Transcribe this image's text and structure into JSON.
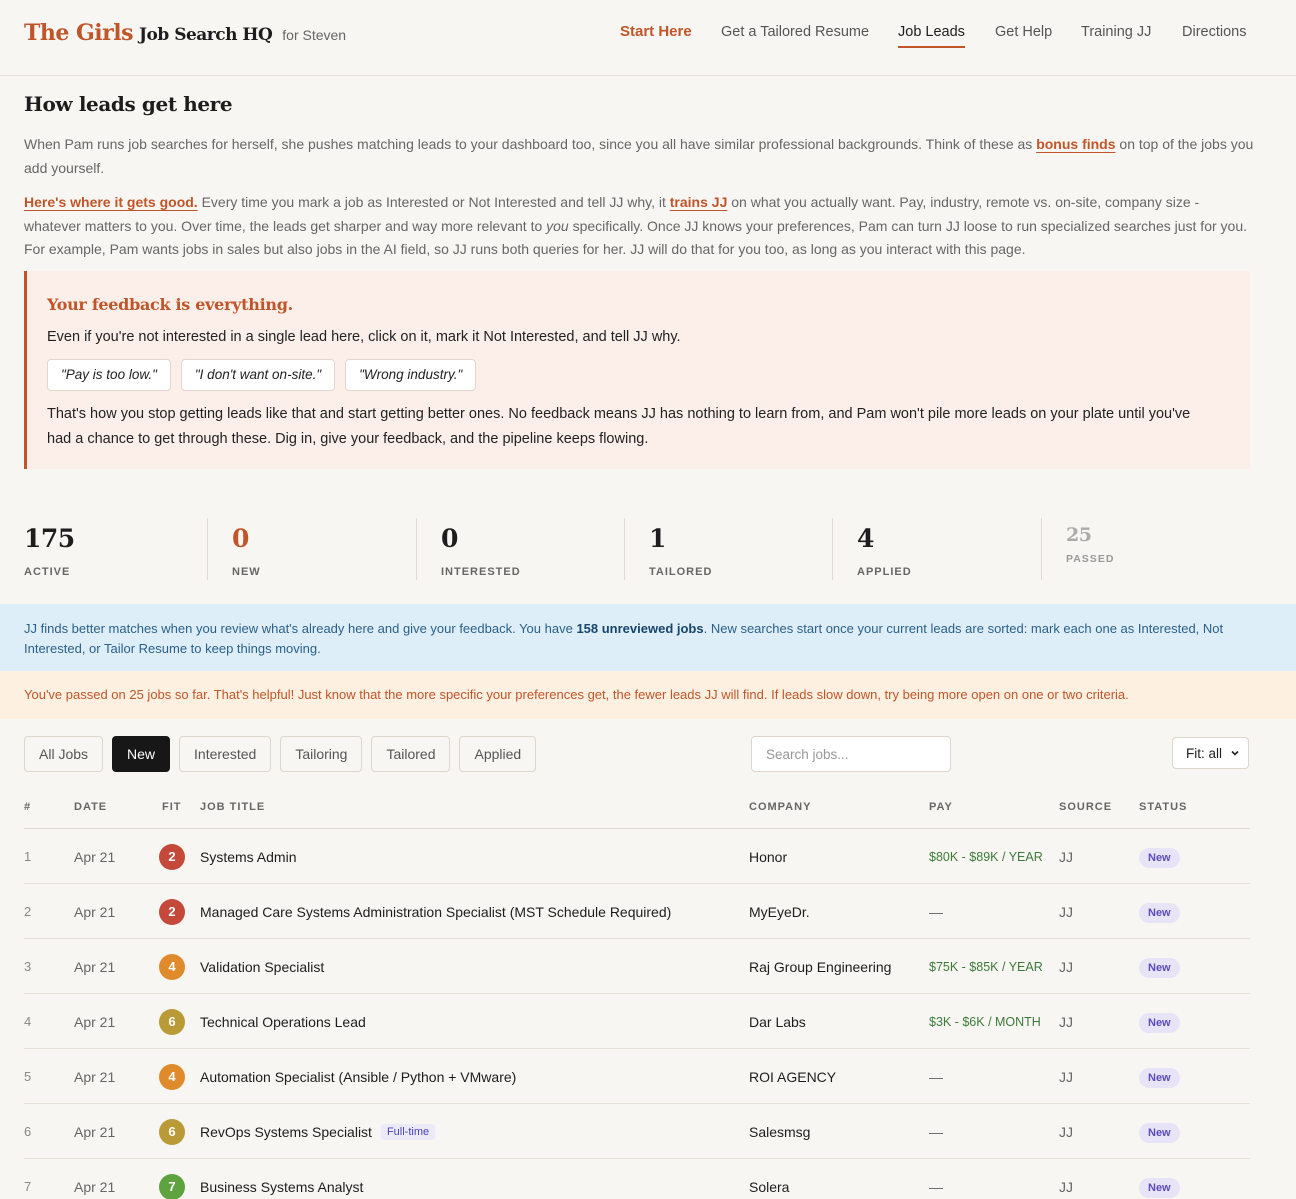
{
  "header": {
    "brand_primary": "The Girls",
    "brand_secondary": "Job Search HQ",
    "brand_user": "for Steven",
    "nav": [
      {
        "label": "Start Here",
        "type": "primary"
      },
      {
        "label": "Get a Tailored Resume",
        "type": "normal"
      },
      {
        "label": "Job Leads",
        "type": "active"
      },
      {
        "label": "Get Help",
        "type": "normal"
      },
      {
        "label": "Training JJ",
        "type": "normal"
      },
      {
        "label": "Directions",
        "type": "normal"
      }
    ]
  },
  "intro": {
    "title": "How leads get here",
    "p1_text": "When Pam runs job searches for herself, she pushes matching leads to your dashboard too, since you all have similar professional backgrounds. Think of these as",
    "p1_link": "bonus finds",
    "p1_tail": "on top of the jobs you add yourself.",
    "p2_link1": "Here's where it gets good.",
    "p2_text1": "Every time you mark a job as Interested or Not Interested and tell JJ why, it",
    "p2_link2": "trains JJ",
    "p2_text2": "on what you actually want. Pay, industry, remote vs. on-site, company size -whatever matters to you. Over time, the leads get sharper and way more relevant to",
    "p2_em": "you",
    "p2_text3": "specifically. Once JJ knows your preferences, Pam can turn JJ loose to run specialized searches just for you. For example, Pam wants jobs in sales but also jobs in the AI field, so JJ runs both queries for her. JJ will do that for you too, as long as you interact with this page."
  },
  "feedback": {
    "title": "Your feedback is everything.",
    "line": "Even if you're not interested in a single lead here, click on it, mark it Not Interested, and tell JJ why.",
    "examples": [
      "\"Pay is too low.\"",
      "\"I don't want on-site.\"",
      "\"Wrong industry.\""
    ],
    "paragraph": "That's how you stop getting leads like that and start getting better ones. No feedback means JJ has nothing to learn from, and Pam won't pile more leads on your plate until you've had a chance to get through these. Dig in, give your feedback, and the pipeline keeps flowing."
  },
  "stats": [
    {
      "value": "175",
      "label": "ACTIVE"
    },
    {
      "value": "0",
      "label": "NEW"
    },
    {
      "value": "0",
      "label": "INTERESTED"
    },
    {
      "value": "1",
      "label": "TAILORED"
    },
    {
      "value": "4",
      "label": "APPLIED"
    },
    {
      "value": "25",
      "label": "PASSED"
    }
  ],
  "banners": {
    "info_pre": "JJ finds better matches when you review what's already here and give your feedback. You have",
    "info_bold": "158 unreviewed jobs",
    "info_post": ". New searches start once your current leads are sorted: mark each one as Interested, Not Interested, or Tailor Resume to keep things moving.",
    "warn": "You've passed on 25 jobs so far. That's helpful! Just know that the more specific your preferences get, the fewer leads JJ will find. If leads slow down, try being more open on one or two criteria."
  },
  "filters": {
    "tabs": [
      "All Jobs",
      "New",
      "Interested",
      "Tailoring",
      "Tailored",
      "Applied"
    ],
    "active": "New",
    "search_placeholder": "Search jobs...",
    "fit_value": "Fit: all"
  },
  "table": {
    "headers": [
      "#",
      "DATE",
      "FIT",
      "JOB TITLE",
      "COMPANY",
      "PAY",
      "SOURCE",
      "STATUS"
    ],
    "rows": [
      {
        "num": "1",
        "date": "Apr 21",
        "fit": "2",
        "title": "Systems Admin",
        "tag": "",
        "company": "Honor",
        "pay": "$80K - $89K / YEAR",
        "source": "JJ",
        "status": "New"
      },
      {
        "num": "2",
        "date": "Apr 21",
        "fit": "2",
        "title": "Managed Care Systems Administration Specialist (MST Schedule Required)",
        "tag": "",
        "company": "MyEyeDr.",
        "pay": "—",
        "source": "JJ",
        "status": "New"
      },
      {
        "num": "3",
        "date": "Apr 21",
        "fit": "4",
        "title": "Validation Specialist",
        "tag": "",
        "company": "Raj Group Engineering",
        "pay": "$75K - $85K / YEAR",
        "source": "JJ",
        "status": "New"
      },
      {
        "num": "4",
        "date": "Apr 21",
        "fit": "6",
        "title": "Technical Operations Lead",
        "tag": "",
        "company": "Dar Labs",
        "pay": "$3K - $6K / MONTH",
        "source": "JJ",
        "status": "New"
      },
      {
        "num": "5",
        "date": "Apr 21",
        "fit": "4",
        "title": "Automation Specialist (Ansible / Python + VMware)",
        "tag": "",
        "company": "ROI AGENCY",
        "pay": "—",
        "source": "JJ",
        "status": "New"
      },
      {
        "num": "6",
        "date": "Apr 21",
        "fit": "6",
        "title": "RevOps Systems Specialist",
        "tag": "Full-time",
        "company": "Salesmsg",
        "pay": "—",
        "source": "JJ",
        "status": "New"
      },
      {
        "num": "7",
        "date": "Apr 21",
        "fit": "7",
        "title": "Business Systems Analyst",
        "tag": "",
        "company": "Solera",
        "pay": "—",
        "source": "JJ",
        "status": "New"
      }
    ]
  },
  "colors": {
    "accent": "#c0552a",
    "fit_low": "#c4493a",
    "fit_mid": "#df8b2c",
    "fit_olive": "#b99a36",
    "fit_good": "#5ea33f",
    "pay_green": "#3c7a3a"
  }
}
